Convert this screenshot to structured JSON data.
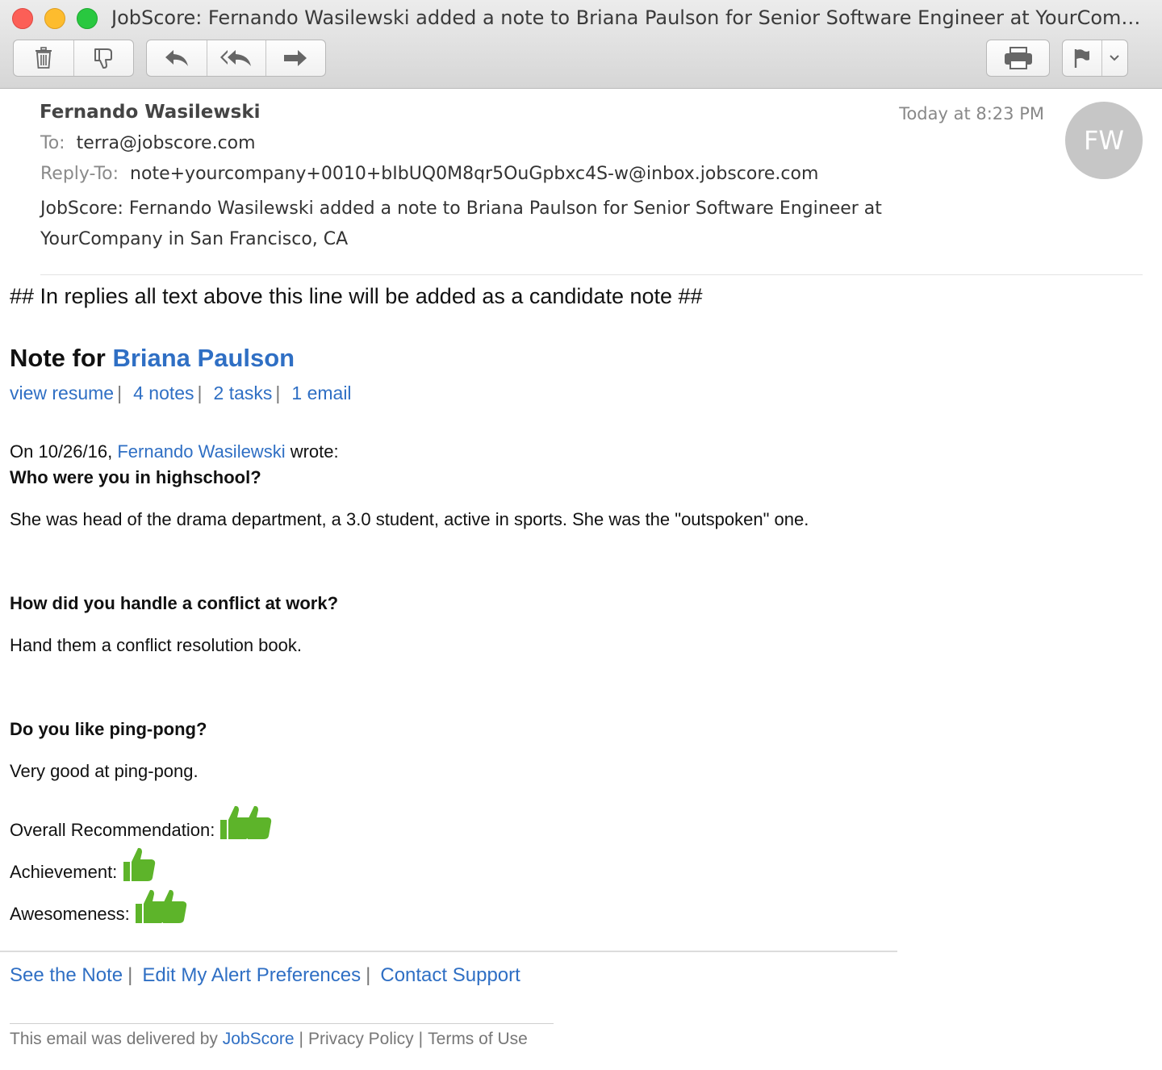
{
  "window": {
    "title": "JobScore: Fernando Wasilewski added a note to Briana Paulson for Senior Software Engineer at YourCompany in San Francisco, CA"
  },
  "toolbar": {
    "buttons": [
      "trash-icon",
      "junk-icon",
      "reply-icon",
      "reply-all-icon",
      "forward-icon",
      "print-icon",
      "flag-icon",
      "chevron-down-icon"
    ]
  },
  "header": {
    "from": "Fernando Wasilewski",
    "date": "Today at 8:23 PM",
    "avatar_initials": "FW",
    "to_label": "To:",
    "to": "terra@jobscore.com",
    "reply_to_label": "Reply-To:",
    "reply_to": "note+yourcompany+0010+bIbUQ0M8qr5OuGpbxc4S-w@inbox.jobscore.com",
    "subject_line1": "JobScore: Fernando Wasilewski added a note to Briana Paulson for Senior Software Engineer at",
    "subject_line2": "YourCompany in San Francisco, CA"
  },
  "body": {
    "reply_notice": "## In replies all text above this line will be added as a candidate note ##",
    "note_for_label": "Note for ",
    "candidate_name": "Briana Paulson",
    "links": [
      "view resume",
      "4 notes",
      "2 tasks",
      "1 email"
    ],
    "link_separator": "|",
    "wrote_prefix": "On 10/26/16, ",
    "wrote_author": "Fernando Wasilewski",
    "wrote_suffix": " wrote:",
    "qa": [
      {
        "question": "Who were you in highschool?",
        "answer": "She was head of the drama department, a 3.0 student, active in sports. She was the \"outspoken\" one."
      },
      {
        "question": "How did you handle a conflict at work?",
        "answer": "Hand them a conflict resolution book."
      },
      {
        "question": "Do you like ping-pong?",
        "answer": "Very good at ping-pong."
      }
    ],
    "ratings": [
      {
        "label": "Overall Recommendation:",
        "thumbs": 2
      },
      {
        "label": "Achievement:",
        "thumbs": 1
      },
      {
        "label": "Awesomeness:",
        "thumbs": 2
      }
    ],
    "accent_color": "#2f6fc4",
    "thumb_color": "#5db42a"
  },
  "footer": {
    "links": [
      "See the Note",
      "Edit My Alert Preferences",
      "Contact Support"
    ],
    "delivered_prefix": "This email was delivered by ",
    "delivered_brand": "JobScore",
    "privacy": "Privacy Policy",
    "terms": "Terms of Use"
  }
}
